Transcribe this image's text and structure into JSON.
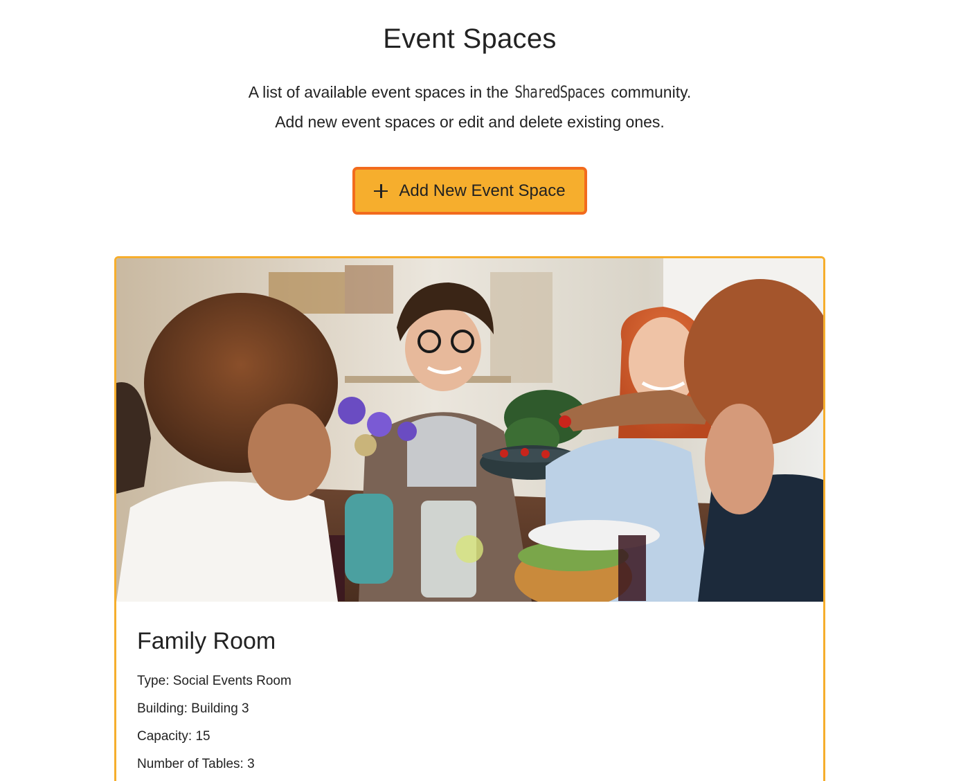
{
  "header": {
    "title": "Event Spaces",
    "intro_before": "A list of available event spaces in the ",
    "brand": "SharedSpaces",
    "intro_after": " community.",
    "intro_line2": "Add new event spaces or edit and delete existing ones."
  },
  "actions": {
    "add_label": "Add New Event Space",
    "add_icon": "plus-icon",
    "button_fill": "#f6ae2d",
    "button_border": "#f26b1d"
  },
  "spaces": [
    {
      "name": "Family Room",
      "type_line": "Type: Social Events Room",
      "building_line": "Building: Building 3",
      "capacity_line": "Capacity: 15",
      "tables_line": "Number of Tables: 3",
      "image": "people-dining-at-table-photo",
      "card_border": "#f6ae2d"
    }
  ]
}
